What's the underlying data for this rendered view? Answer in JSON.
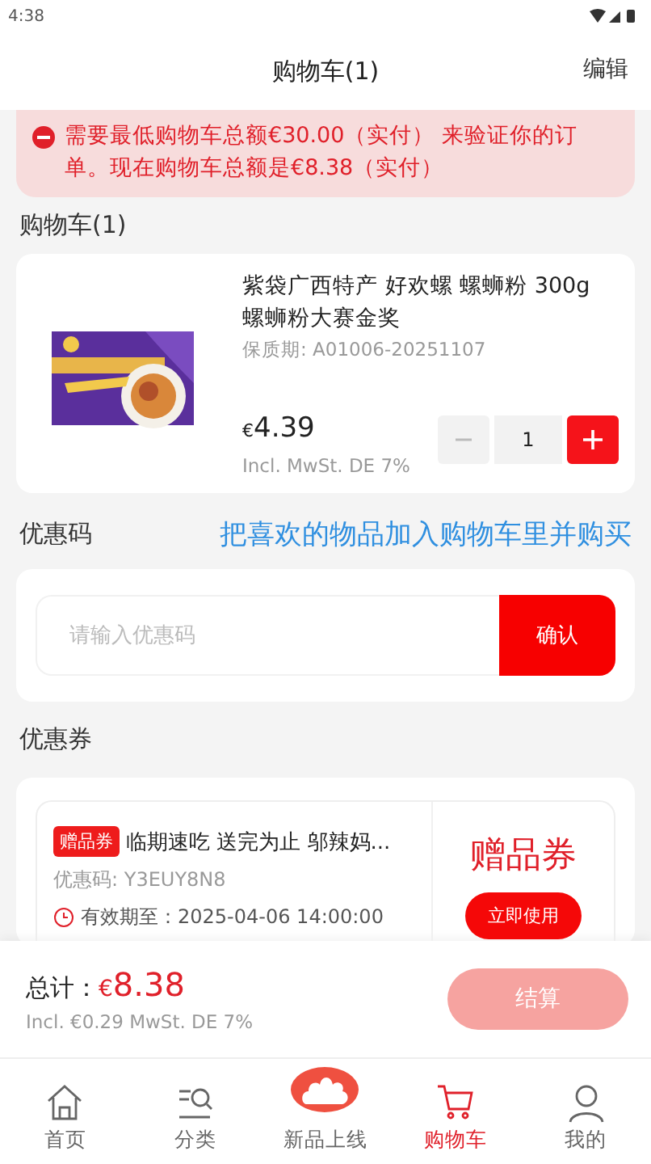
{
  "status_bar": {
    "time": "4:38"
  },
  "header": {
    "title": "购物车(1)",
    "action": "编辑"
  },
  "warning": {
    "text": "需要最低购物车总额€30.00（实付） 来验证你的订单。现在购物车总额是€8.38（实付）"
  },
  "cart": {
    "label": "购物车(1)",
    "items": [
      {
        "name": "紫袋广西特产 好欢螺 螺蛳粉 300g 螺蛳粉大赛金奖",
        "shelf_life": "保质期: A01006-20251107",
        "currency": "€",
        "price": "4.39",
        "tax": "Incl. MwSt. DE 7%",
        "quantity": "1",
        "decrease_disabled": true
      }
    ]
  },
  "promo": {
    "label": "优惠码",
    "banner": "把喜欢的物品加入购物车里并购买",
    "placeholder": "请输入优惠码",
    "confirm": "确认"
  },
  "coupons": {
    "label": "优惠券",
    "items": [
      {
        "tag": "赠品券",
        "title": "临期速吃 送完为止 邬辣妈...",
        "code": "优惠码: Y3EUY8N8",
        "expiry": "有效期至：2025-04-06 14:00:00",
        "type_label": "赠品券",
        "use": "立即使用"
      }
    ]
  },
  "checkout": {
    "total_label": "总计：",
    "currency": "€",
    "total": "8.38",
    "tax": "Incl. €0.29 MwSt. DE 7%",
    "button": "结算",
    "disabled": true
  },
  "nav": [
    {
      "label": "首页",
      "selected": false
    },
    {
      "label": "分类",
      "selected": false
    },
    {
      "label": "新品上线",
      "selected": false
    },
    {
      "label": "购物车",
      "selected": true
    },
    {
      "label": "我的",
      "selected": false
    }
  ]
}
